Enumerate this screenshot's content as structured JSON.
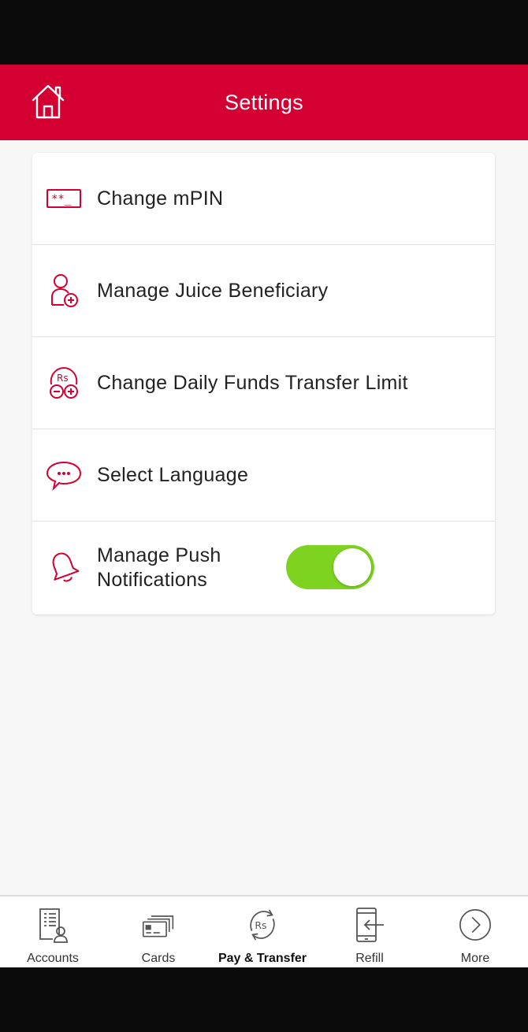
{
  "header": {
    "title": "Settings",
    "home_icon": "home-icon"
  },
  "settings": [
    {
      "label": "Change mPIN",
      "icon": "pin-card-icon"
    },
    {
      "label": "Manage Juice Beneficiary",
      "icon": "add-user-icon"
    },
    {
      "label": "Change Daily Funds Transfer Limit",
      "icon": "rupee-limit-icon"
    },
    {
      "label": "Select Language",
      "icon": "chat-bubble-icon"
    },
    {
      "label": "Manage Push Notifications",
      "icon": "bell-icon",
      "toggle_on": true
    }
  ],
  "tabs": [
    {
      "label": "Accounts",
      "icon": "accounts-icon"
    },
    {
      "label": "Cards",
      "icon": "cards-icon"
    },
    {
      "label": "Pay & Transfer",
      "icon": "pay-transfer-icon",
      "active": true
    },
    {
      "label": "Refill",
      "icon": "refill-icon"
    },
    {
      "label": "More",
      "icon": "chevron-right-circle-icon"
    }
  ],
  "colors": {
    "brand": "#d50032",
    "toggle_on": "#7ed321",
    "icon_red": "#d50032"
  }
}
